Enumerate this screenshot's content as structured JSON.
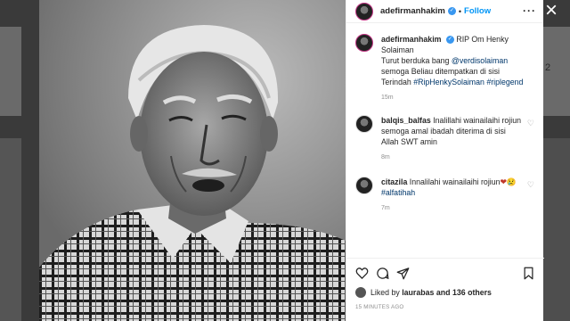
{
  "post": {
    "username": "adefirmanhakim",
    "follow_label": "Follow",
    "more_icon": "more-horizontal-icon",
    "caption": {
      "username": "adefirmanhakim",
      "line1": "RIP Om Henky Solaiman",
      "line2": "Turut berduka bang",
      "mention": "@verdisolaiman",
      "line3": "semoga Beliau ditempatkan di sisi Terindah",
      "hashtag1": "#RipHenkySolaiman",
      "hashtag2": "#riplegend",
      "time": "15m"
    },
    "comments": [
      {
        "username": "balqis_balfas",
        "text": "Inalillahi wainailaihi rojiun semoga amal ibadah diterima di sisi Allah SWT amin",
        "time": "8m"
      },
      {
        "username": "citazila",
        "text_before": "Innalilahi wainailaihi rojiun",
        "emoji": "❤😢",
        "hashtag": "#alfatihah",
        "time": "7m"
      }
    ],
    "likes_prefix": "Liked by",
    "liked_by_user": "laurabas",
    "likes_suffix": "and 136 others",
    "timestamp": "15 MINUTES AGO"
  },
  "backdrop": {
    "right_text": "2"
  },
  "colors": {
    "link": "#0095f6",
    "tag": "#00376b",
    "muted": "#8e8e8e"
  }
}
